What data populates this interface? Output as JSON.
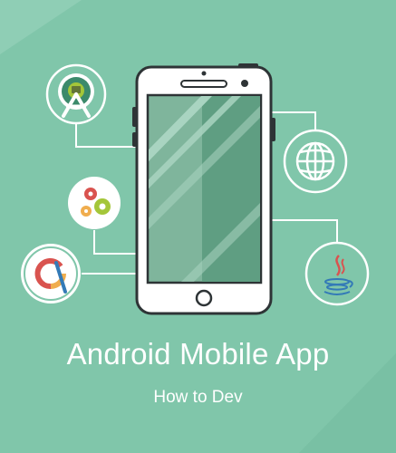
{
  "banner": {
    "title": "Android Mobile App",
    "subtitle": "How to Dev"
  },
  "icons": {
    "android_studio": "android-studio-icon",
    "gears": "gears-icon",
    "app_inventor": "app-inventor-icon",
    "globe": "globe-icon",
    "java": "java-icon",
    "phone": "smartphone-icon"
  },
  "colors": {
    "background": "#80C6AA",
    "phone_outline": "#2E3436",
    "screen_glass": "#7FB59C",
    "screen_dark": "#5F9E82",
    "connector": "#FFFFFF"
  }
}
